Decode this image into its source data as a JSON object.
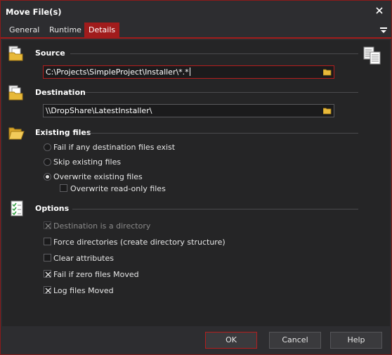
{
  "window": {
    "title": "Move File(s)"
  },
  "tabs": [
    {
      "label": "General"
    },
    {
      "label": "Runtime"
    },
    {
      "label": "Details"
    }
  ],
  "source": {
    "heading": "Source",
    "value": "C:\\Projects\\SimpleProject\\Installer\\*.*"
  },
  "destination": {
    "heading": "Destination",
    "value": "\\\\DropShare\\LatestInstaller\\"
  },
  "existing_files": {
    "heading": "Existing files",
    "options": [
      {
        "label": "Fail if any destination files exist",
        "selected": false
      },
      {
        "label": "Skip existing files",
        "selected": false
      },
      {
        "label": "Overwrite existing files",
        "selected": true
      }
    ],
    "overwrite_readonly": {
      "label": "Overwrite read-only files",
      "checked": false
    }
  },
  "options": {
    "heading": "Options",
    "items": [
      {
        "label": "Destination is a directory",
        "checked": true,
        "disabled": true
      },
      {
        "label": "Force directories (create directory structure)",
        "checked": false,
        "disabled": false
      },
      {
        "label": "Clear attributes",
        "checked": false,
        "disabled": false
      },
      {
        "label": "Fail if zero files Moved",
        "checked": true,
        "disabled": false
      },
      {
        "label": "Log files Moved",
        "checked": true,
        "disabled": false
      }
    ]
  },
  "buttons": {
    "ok": "OK",
    "cancel": "Cancel",
    "help": "Help"
  },
  "colors": {
    "accent": "#a11c1c",
    "background": "#252526",
    "chrome": "#2d2d30"
  }
}
